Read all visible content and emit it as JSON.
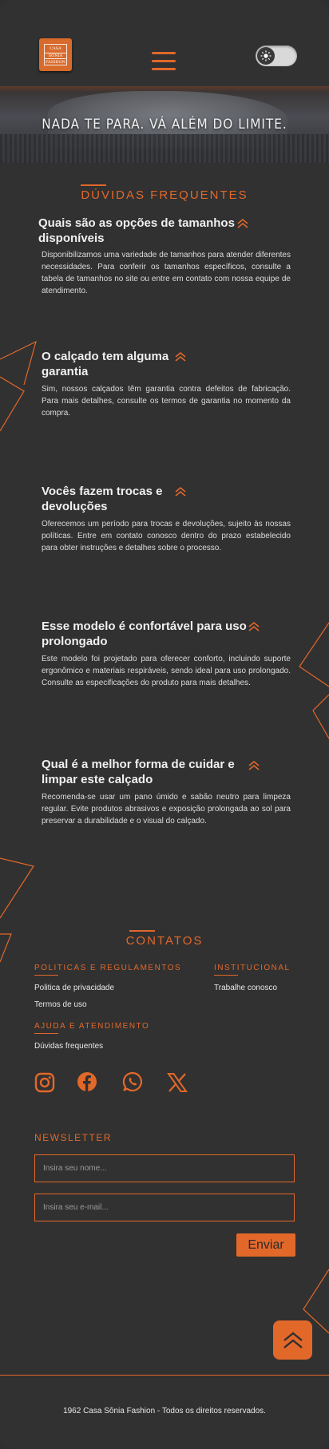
{
  "logo": {
    "line1": "CASA",
    "line2": "SÔNIA",
    "line3": "FASHION"
  },
  "banner": {
    "tagline": "NADA TE PARA. VÁ ALÉM DO LIMITE."
  },
  "faq": {
    "title": "DÚVIDAS FREQUENTES",
    "items": [
      {
        "q": "Quais são as opções de tamanhos disponíveis",
        "a": "Disponibilizamos uma variedade de tamanhos para atender diferentes necessidades. Para conferir os tamanhos específicos, consulte a tabela de tamanhos no site ou entre em contato com nossa equipe de atendimento."
      },
      {
        "q": "O calçado tem alguma garantia",
        "a": "Sim, nossos calçados têm garantia contra defeitos de fabricação. Para mais detalhes, consulte os termos de garantia no momento da compra."
      },
      {
        "q": "Vocês fazem trocas e devoluções",
        "a": "Oferecemos um período para trocas e devoluções, sujeito às nossas políticas. Entre em contato conosco dentro do prazo estabelecido para obter instruções e detalhes sobre o processo."
      },
      {
        "q": "Esse modelo é confortável para uso prolongado",
        "a": "Este modelo foi projetado para oferecer conforto, incluindo suporte ergonômico e materiais respiráveis, sendo ideal para uso prolongado. Consulte as especificações do produto para mais detalhes."
      },
      {
        "q": "Qual é a melhor forma de cuidar e limpar este calçado",
        "a": "Recomenda-se usar um pano úmido e sabão neutro para limpeza regular. Evite produtos abrasivos e exposição prolongada ao sol para preservar a durabilidade e o visual do calçado."
      }
    ]
  },
  "contacts": {
    "title": "CONTATOS",
    "policies": {
      "title": "POLITICAS E REGULAMENTOS",
      "links": [
        "Politica de privacidade",
        "Termos de uso"
      ]
    },
    "institutional": {
      "title": "INSTITUCIONAL",
      "links": [
        "Trabalhe conosco"
      ]
    },
    "help": {
      "title": "AJUDA E ATENDIMENTO",
      "links": [
        "Dúvidas frequentes"
      ]
    },
    "social": [
      "instagram-icon",
      "facebook-icon",
      "whatsapp-icon",
      "x-icon"
    ]
  },
  "newsletter": {
    "title": "NEWSLETTER",
    "name_placeholder": "Insira seu nome...",
    "email_placeholder": "Insira seu e-mail...",
    "send_label": "Enviar"
  },
  "footer": {
    "copyright": "1962 Casa Sônia Fashion - Todos os direitos reservados."
  },
  "colors": {
    "accent": "#e2682a",
    "background": "#313131",
    "text": "#e8e8e8"
  }
}
